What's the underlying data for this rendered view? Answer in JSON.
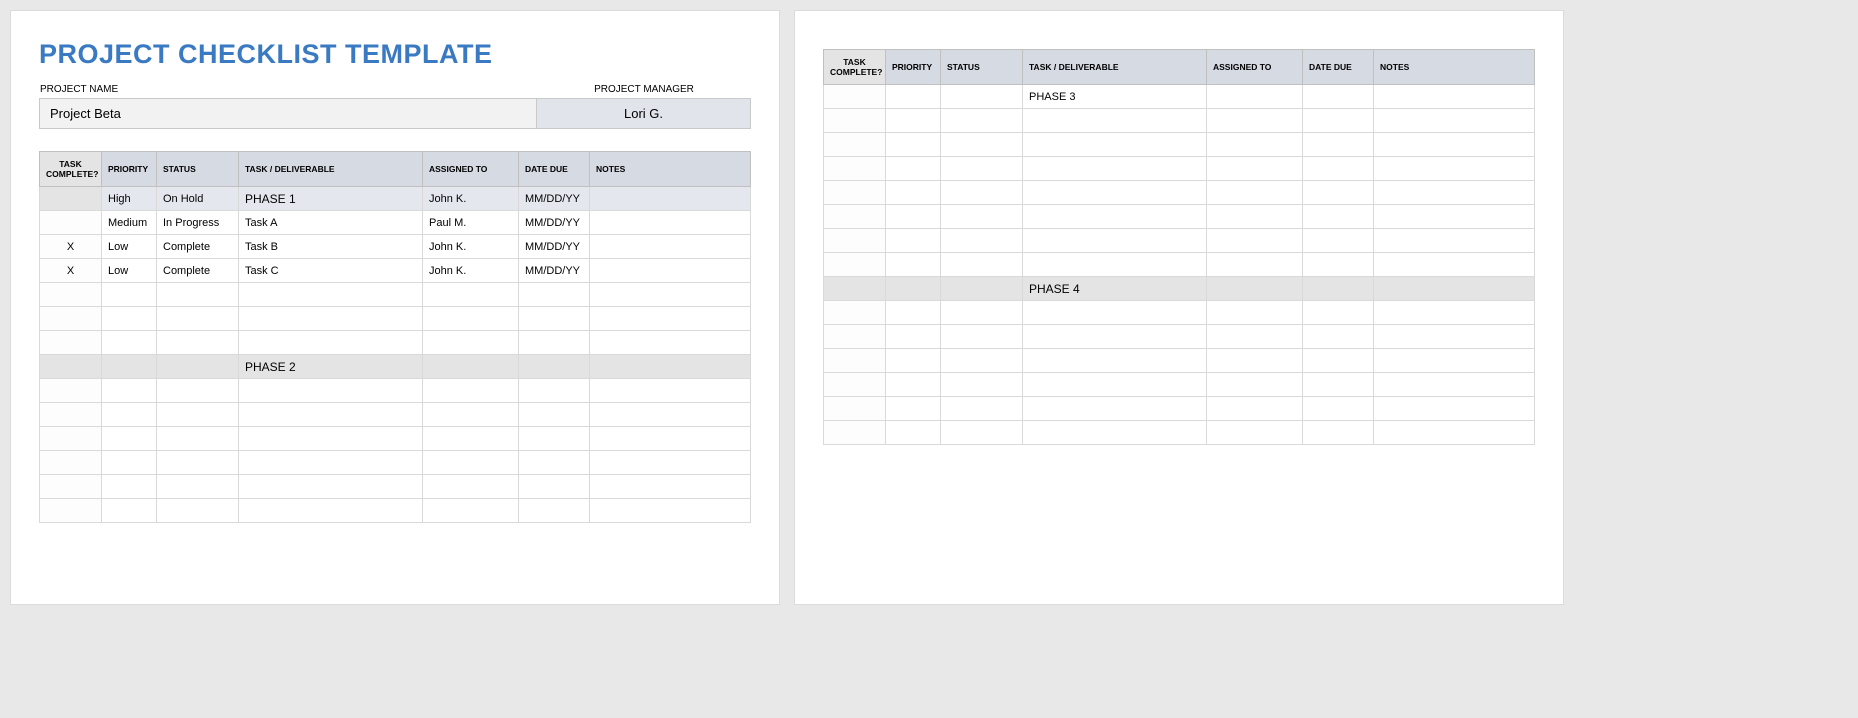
{
  "title": "PROJECT CHECKLIST TEMPLATE",
  "meta": {
    "project_name_label": "PROJECT NAME",
    "project_name": "Project Beta",
    "project_manager_label": "PROJECT MANAGER",
    "project_manager": "Lori G."
  },
  "columns": {
    "complete": "TASK COMPLETE?",
    "priority": "PRIORITY",
    "status": "STATUS",
    "task": "TASK  / DELIVERABLE",
    "assigned": "ASSIGNED TO",
    "date_due": "DATE DUE",
    "notes": "NOTES"
  },
  "page1_rows": [
    {
      "type": "phase",
      "complete": "",
      "priority": "High",
      "status": "On Hold",
      "task": "PHASE 1",
      "assigned": "John K.",
      "date_due": "MM/DD/YY",
      "notes": ""
    },
    {
      "type": "data",
      "complete": "",
      "priority": "Medium",
      "status": "In Progress",
      "task": "Task A",
      "assigned": "Paul M.",
      "date_due": "MM/DD/YY",
      "notes": ""
    },
    {
      "type": "data",
      "complete": "X",
      "priority": "Low",
      "status": "Complete",
      "task": "Task B",
      "assigned": "John K.",
      "date_due": "MM/DD/YY",
      "notes": ""
    },
    {
      "type": "data",
      "complete": "X",
      "priority": "Low",
      "status": "Complete",
      "task": "Task C",
      "assigned": "John K.",
      "date_due": "MM/DD/YY",
      "notes": ""
    },
    {
      "type": "data",
      "complete": "",
      "priority": "",
      "status": "",
      "task": "",
      "assigned": "",
      "date_due": "",
      "notes": ""
    },
    {
      "type": "data",
      "complete": "",
      "priority": "",
      "status": "",
      "task": "",
      "assigned": "",
      "date_due": "",
      "notes": ""
    },
    {
      "type": "data",
      "complete": "",
      "priority": "",
      "status": "",
      "task": "",
      "assigned": "",
      "date_due": "",
      "notes": ""
    },
    {
      "type": "gray",
      "complete": "",
      "priority": "",
      "status": "",
      "task": "PHASE 2",
      "assigned": "",
      "date_due": "",
      "notes": ""
    },
    {
      "type": "data",
      "complete": "",
      "priority": "",
      "status": "",
      "task": "",
      "assigned": "",
      "date_due": "",
      "notes": ""
    },
    {
      "type": "data",
      "complete": "",
      "priority": "",
      "status": "",
      "task": "",
      "assigned": "",
      "date_due": "",
      "notes": ""
    },
    {
      "type": "data",
      "complete": "",
      "priority": "",
      "status": "",
      "task": "",
      "assigned": "",
      "date_due": "",
      "notes": ""
    },
    {
      "type": "data",
      "complete": "",
      "priority": "",
      "status": "",
      "task": "",
      "assigned": "",
      "date_due": "",
      "notes": ""
    },
    {
      "type": "data",
      "complete": "",
      "priority": "",
      "status": "",
      "task": "",
      "assigned": "",
      "date_due": "",
      "notes": ""
    },
    {
      "type": "data",
      "complete": "",
      "priority": "",
      "status": "",
      "task": "",
      "assigned": "",
      "date_due": "",
      "notes": ""
    }
  ],
  "page2_rows": [
    {
      "type": "data",
      "complete": "",
      "priority": "",
      "status": "",
      "task": "PHASE 3",
      "assigned": "",
      "date_due": "",
      "notes": ""
    },
    {
      "type": "data",
      "complete": "",
      "priority": "",
      "status": "",
      "task": "",
      "assigned": "",
      "date_due": "",
      "notes": ""
    },
    {
      "type": "data",
      "complete": "",
      "priority": "",
      "status": "",
      "task": "",
      "assigned": "",
      "date_due": "",
      "notes": ""
    },
    {
      "type": "data",
      "complete": "",
      "priority": "",
      "status": "",
      "task": "",
      "assigned": "",
      "date_due": "",
      "notes": ""
    },
    {
      "type": "data",
      "complete": "",
      "priority": "",
      "status": "",
      "task": "",
      "assigned": "",
      "date_due": "",
      "notes": ""
    },
    {
      "type": "data",
      "complete": "",
      "priority": "",
      "status": "",
      "task": "",
      "assigned": "",
      "date_due": "",
      "notes": ""
    },
    {
      "type": "data",
      "complete": "",
      "priority": "",
      "status": "",
      "task": "",
      "assigned": "",
      "date_due": "",
      "notes": ""
    },
    {
      "type": "data",
      "complete": "",
      "priority": "",
      "status": "",
      "task": "",
      "assigned": "",
      "date_due": "",
      "notes": ""
    },
    {
      "type": "gray",
      "complete": "",
      "priority": "",
      "status": "",
      "task": "PHASE 4",
      "assigned": "",
      "date_due": "",
      "notes": ""
    },
    {
      "type": "data",
      "complete": "",
      "priority": "",
      "status": "",
      "task": "",
      "assigned": "",
      "date_due": "",
      "notes": ""
    },
    {
      "type": "data",
      "complete": "",
      "priority": "",
      "status": "",
      "task": "",
      "assigned": "",
      "date_due": "",
      "notes": ""
    },
    {
      "type": "data",
      "complete": "",
      "priority": "",
      "status": "",
      "task": "",
      "assigned": "",
      "date_due": "",
      "notes": ""
    },
    {
      "type": "data",
      "complete": "",
      "priority": "",
      "status": "",
      "task": "",
      "assigned": "",
      "date_due": "",
      "notes": ""
    },
    {
      "type": "data",
      "complete": "",
      "priority": "",
      "status": "",
      "task": "",
      "assigned": "",
      "date_due": "",
      "notes": ""
    },
    {
      "type": "data",
      "complete": "",
      "priority": "",
      "status": "",
      "task": "",
      "assigned": "",
      "date_due": "",
      "notes": ""
    }
  ]
}
